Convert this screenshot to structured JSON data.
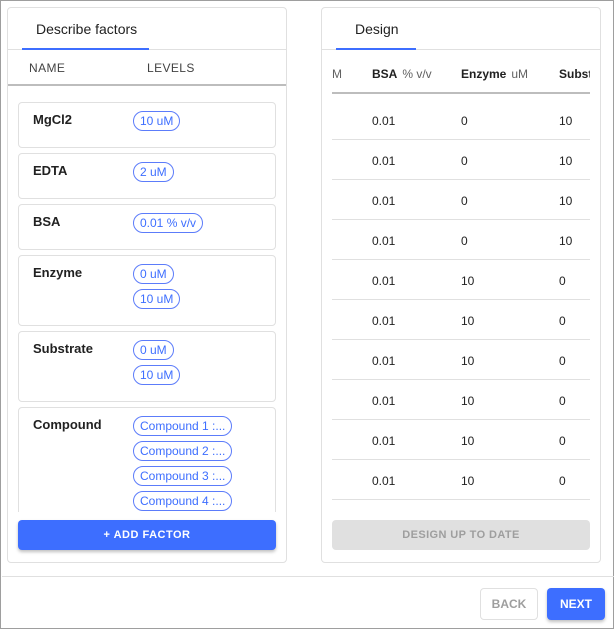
{
  "factors_panel": {
    "tab_label": "Describe factors",
    "col_name": "NAME",
    "col_levels": "LEVELS",
    "factors": [
      {
        "name": "MgCl2",
        "levels": [
          "10 uM"
        ]
      },
      {
        "name": "EDTA",
        "levels": [
          "2 uM"
        ]
      },
      {
        "name": "BSA",
        "levels": [
          "0.01 % v/v"
        ]
      },
      {
        "name": "Enzyme",
        "levels": [
          "0 uM",
          "10 uM"
        ]
      },
      {
        "name": "Substrate",
        "levels": [
          "0 uM",
          "10 uM"
        ]
      },
      {
        "name": "Compound",
        "levels": [
          "Compound 1 :...",
          "Compound 2 :...",
          "Compound 3 :...",
          "Compound 4 :..."
        ]
      }
    ],
    "add_button_label": "+ ADD FACTOR"
  },
  "design_panel": {
    "tab_label": "Design",
    "columns": [
      {
        "name": "",
        "unit": "M"
      },
      {
        "name": "BSA",
        "unit": "% v/v"
      },
      {
        "name": "Enzyme",
        "unit": "uM"
      },
      {
        "name": "Subst",
        "unit": ""
      }
    ],
    "rows": [
      [
        "0.01",
        "0",
        "10"
      ],
      [
        "0.01",
        "0",
        "10"
      ],
      [
        "0.01",
        "0",
        "10"
      ],
      [
        "0.01",
        "0",
        "10"
      ],
      [
        "0.01",
        "10",
        "0"
      ],
      [
        "0.01",
        "10",
        "0"
      ],
      [
        "0.01",
        "10",
        "0"
      ],
      [
        "0.01",
        "10",
        "0"
      ],
      [
        "0.01",
        "10",
        "0"
      ],
      [
        "0.01",
        "10",
        "0"
      ]
    ],
    "status_button_label": "DESIGN UP TO DATE"
  },
  "footer": {
    "back_label": "BACK",
    "next_label": "NEXT"
  },
  "colors": {
    "accent": "#3d6eff",
    "disabled": "#e0e0e0"
  }
}
